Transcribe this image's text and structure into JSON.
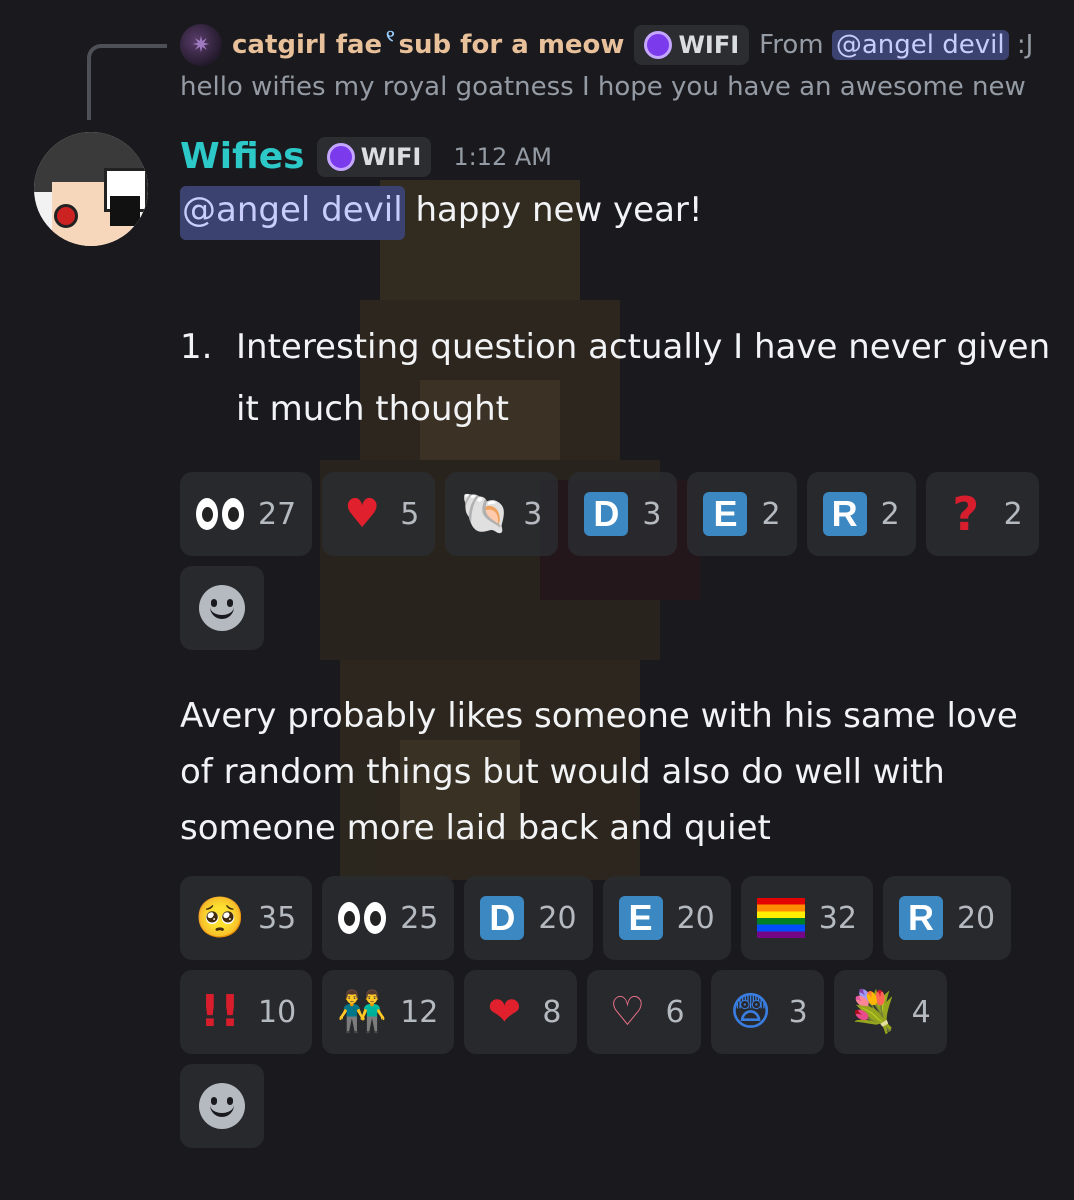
{
  "reply": {
    "username": "catgirl fae",
    "username_suffix": "sub for a meow",
    "tag": "WIFI",
    "from_prefix": "From",
    "from_mention": "@angel devil",
    "from_suffix": ":J",
    "text": "hello wifies my royal goatness I hope you have an awesome new"
  },
  "message": {
    "author": "Wifies",
    "tag": "WIFI",
    "timestamp": "1:12 AM",
    "mention": "@angel devil",
    "greeting": "happy new year!",
    "list_number": "1.",
    "list_text": "Interesting question actually I have never given it much thought",
    "paragraph": "Avery probably likes someone with his same love of random things but would also do well with someone more laid back and quiet"
  },
  "reactions_1": [
    {
      "icon": "eyes-emoji",
      "count": "27"
    },
    {
      "icon": "red-heart-emoji",
      "count": "5"
    },
    {
      "icon": "spiral-shell-emoji",
      "count": "3"
    },
    {
      "icon": "letter-d-emoji",
      "letter": "D",
      "count": "3"
    },
    {
      "icon": "letter-e-emoji",
      "letter": "E",
      "count": "2"
    },
    {
      "icon": "letter-r-emoji",
      "letter": "R",
      "count": "2"
    },
    {
      "icon": "question-mark-emoji",
      "count": "2"
    }
  ],
  "reactions_2": [
    {
      "icon": "pleading-face-emoji",
      "count": "35"
    },
    {
      "icon": "eyes-emoji",
      "count": "25"
    },
    {
      "icon": "letter-d-emoji",
      "letter": "D",
      "count": "20"
    },
    {
      "icon": "letter-e-emoji",
      "letter": "E",
      "count": "20"
    },
    {
      "icon": "rainbow-flag-emoji",
      "count": "32"
    },
    {
      "icon": "letter-r-emoji",
      "letter": "R",
      "count": "20"
    },
    {
      "icon": "double-exclamation-emoji",
      "count": "10"
    },
    {
      "icon": "two-men-holding-hands-emoji",
      "count": "12"
    },
    {
      "icon": "mending-heart-emoji",
      "count": "8"
    },
    {
      "icon": "heart-decoration-emoji",
      "count": "6"
    },
    {
      "icon": "astonished-face-emoji",
      "count": "3"
    },
    {
      "icon": "bouquet-emoji",
      "count": "4"
    }
  ],
  "colors": {
    "background": "#1a1a1e",
    "author": "#2dc8c8",
    "mention_bg": "#3c4270",
    "reply_name": "#e8c09a",
    "letter_tile": "#3b88c3"
  }
}
